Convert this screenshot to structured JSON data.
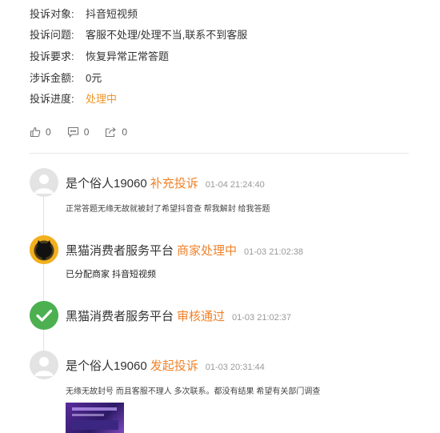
{
  "info": {
    "rows": [
      {
        "label": "投诉对象:",
        "value": "抖音短视频"
      },
      {
        "label": "投诉问题:",
        "value": "客服不处理/处理不当,联系不到客服"
      },
      {
        "label": "投诉要求:",
        "value": "恢复异常正常答题"
      },
      {
        "label": "涉诉金额:",
        "value": "0元"
      },
      {
        "label": "投诉进度:",
        "value": "处理中"
      }
    ]
  },
  "actions": {
    "like_count": "0",
    "comment_count": "0",
    "share_count": "0"
  },
  "timeline": [
    {
      "user": "是个俗人19060",
      "action": "补充投诉",
      "time": "01-04 21:24:40",
      "text": "正常答题无缘无故就被封了希望抖音查 帮我解封 给我答题"
    },
    {
      "user": "黑猫消费者服务平台",
      "action": "商家处理中",
      "time": "01-03 21:02:38",
      "text": "已分配商家 抖音短视频"
    },
    {
      "user": "黑猫消费者服务平台",
      "action": "审核通过",
      "time": "01-03 21:02:37",
      "text": ""
    },
    {
      "user": "是个俗人19060",
      "action": "发起投诉",
      "time": "01-03 20:31:44",
      "text": "无缘无故封号 而且客服不理人 多次联系。都没有结果 希望有关部门调查"
    }
  ],
  "colors": {
    "accent": "#f0822a",
    "progress": "#f0962a",
    "check": "#4cb050",
    "divider": "#e8e8e8"
  }
}
